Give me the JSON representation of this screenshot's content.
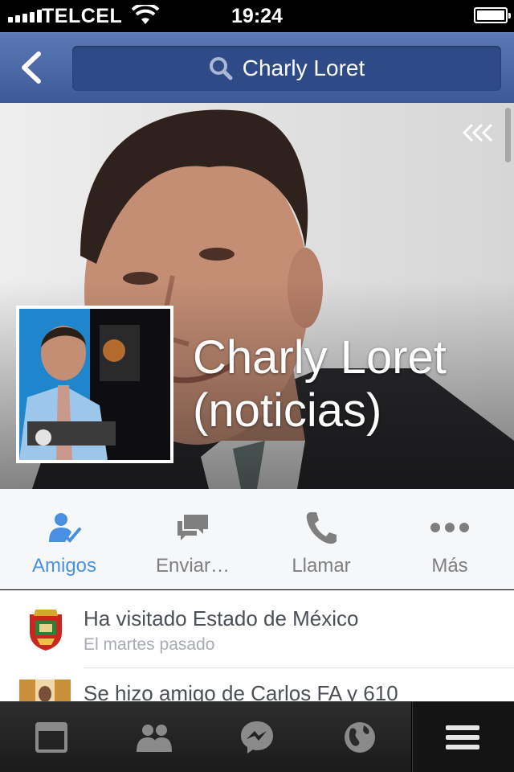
{
  "status_bar": {
    "carrier": "TELCEL",
    "time": "19:24",
    "signal_bars": 5,
    "battery_level": 0.9,
    "icons": [
      "signal-icon",
      "wifi-icon",
      "battery-icon"
    ]
  },
  "nav": {
    "back_icon": "chevron-left-icon",
    "search_icon": "search-icon",
    "search_text": "Charly Loret"
  },
  "profile": {
    "name_line1": "Charly Loret",
    "name_line2": "(noticias)",
    "collapse_icon": "triple-chevron-left-icon"
  },
  "actions": [
    {
      "label": "Amigos",
      "icon": "friend-check-icon",
      "active": true
    },
    {
      "label": "Enviar…",
      "icon": "message-bubbles-icon",
      "active": false
    },
    {
      "label": "Llamar",
      "icon": "phone-icon",
      "active": false
    },
    {
      "label": "Más",
      "icon": "more-dots-icon",
      "active": false
    }
  ],
  "feed": [
    {
      "title": "Ha visitado Estado de México",
      "subtitle": "El martes pasado",
      "icon": "coat-of-arms-icon"
    },
    {
      "title": "Se hizo amigo de Carlos FA y 610",
      "subtitle": "",
      "icon": "friend-photo-thumbnail"
    }
  ],
  "tab_bar": [
    {
      "name": "news-feed",
      "icon": "news-feed-icon",
      "selected": false
    },
    {
      "name": "friend-requests",
      "icon": "people-icon",
      "selected": false
    },
    {
      "name": "messages",
      "icon": "messenger-icon",
      "selected": false
    },
    {
      "name": "notifications",
      "icon": "globe-icon",
      "selected": false
    },
    {
      "name": "more",
      "icon": "hamburger-menu-icon",
      "selected": true
    }
  ],
  "colors": {
    "nav_blue": "#3d5a98",
    "search_field": "#2f4b87",
    "active_action": "#4a90e2",
    "inactive_action": "#7f7f7f",
    "tab_bar": "#1b1b1b"
  }
}
